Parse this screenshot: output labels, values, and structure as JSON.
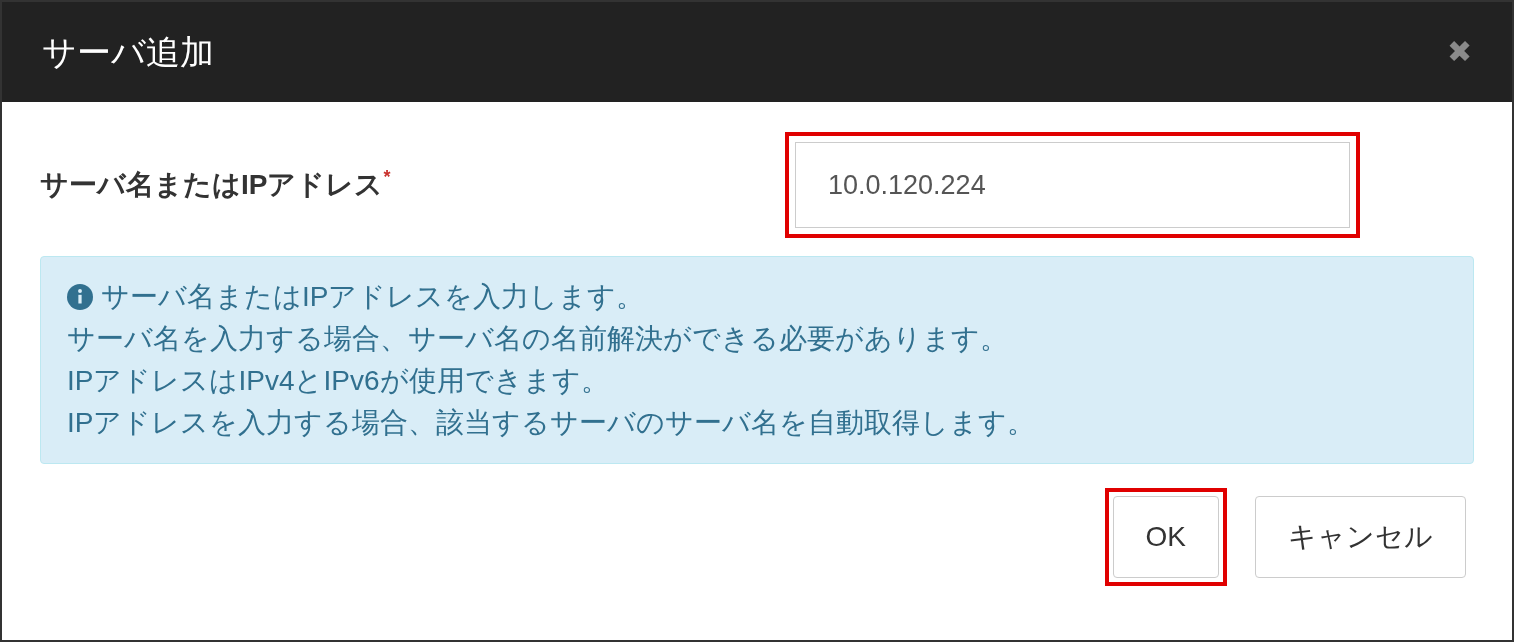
{
  "dialog": {
    "title": "サーバ追加",
    "close": "✖"
  },
  "field": {
    "label": "サーバ名またはIPアドレス",
    "required": true,
    "required_mark": "*",
    "value": "10.0.120.224",
    "highlighted": true
  },
  "info": {
    "lines": [
      "サーバ名またはIPアドレスを入力します。",
      "サーバ名を入力する場合、サーバ名の名前解決ができる必要があります。",
      "IPアドレスはIPv4とIPv6が使用できます。",
      "IPアドレスを入力する場合、該当するサーバのサーバ名を自動取得します。"
    ]
  },
  "buttons": [
    {
      "label": "OK",
      "highlighted": true
    },
    {
      "label": "キャンセル",
      "highlighted": false
    }
  ]
}
